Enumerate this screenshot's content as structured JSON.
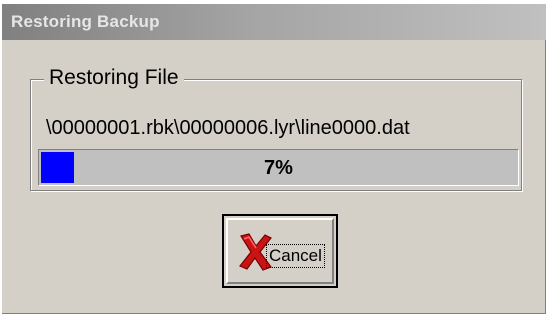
{
  "window": {
    "title": "Restoring Backup"
  },
  "group": {
    "label": "Restoring File",
    "current_file": "\\00000001.rbk\\00000006.lyr\\line0000.dat"
  },
  "progress": {
    "percent": 7,
    "label": "7%"
  },
  "cancel_button": {
    "label": "Cancel",
    "icon": "red-x-icon"
  },
  "colors": {
    "progress_fill": "#0000ff",
    "dialog_face": "#d4d0c8",
    "icon_red": "#c81414"
  }
}
